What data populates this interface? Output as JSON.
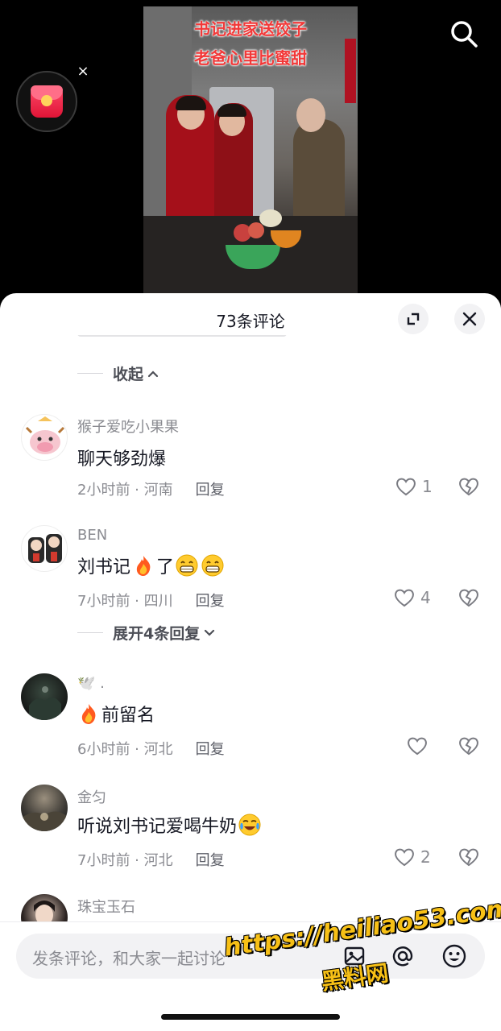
{
  "video": {
    "caption_line1": "书记进家送饺子",
    "caption_line2": "老爸心里比蜜甜"
  },
  "overlay": {
    "close_glyph": "×",
    "icons": [
      "search-icon",
      "red-packet-icon",
      "close-icon"
    ]
  },
  "sheet": {
    "title": "73条评论",
    "collapse_label": "收起",
    "icons": [
      "expand-icon",
      "close-icon"
    ]
  },
  "comments": [
    {
      "username": "猴子爱吃小果果",
      "text": "聊天够劲爆",
      "time_location": "2小时前 · 河南",
      "reply_label": "回复",
      "likes": "1"
    },
    {
      "username": "BEN",
      "text_before": "刘书记",
      "text_mid": "了",
      "emojis": [
        "fire",
        "grin",
        "grin"
      ],
      "time_location": "7小时前 · 四川",
      "reply_label": "回复",
      "likes": "4",
      "expand_label": "展开4条回复"
    },
    {
      "username": "🕊️ .",
      "text": "前留名",
      "emojis": [
        "fire"
      ],
      "time_location": "6小时前 · 河北",
      "reply_label": "回复",
      "likes": ""
    },
    {
      "username": "金匀",
      "text": "听说刘书记爱喝牛奶",
      "emojis": [
        "laugh-cry"
      ],
      "time_location": "7小时前 · 河北",
      "reply_label": "回复",
      "likes": "2"
    },
    {
      "username": "珠宝玉石"
    }
  ],
  "input": {
    "placeholder": "发条评论，和大家一起讨论",
    "icons": [
      "image-icon",
      "at-icon",
      "emoji-icon"
    ]
  },
  "watermark": {
    "url": "https://heiliao53.com",
    "name": "黑料网"
  },
  "colors": {
    "accent_red": "#f23838",
    "text_primary": "#161823",
    "text_secondary": "#8a8b91"
  }
}
